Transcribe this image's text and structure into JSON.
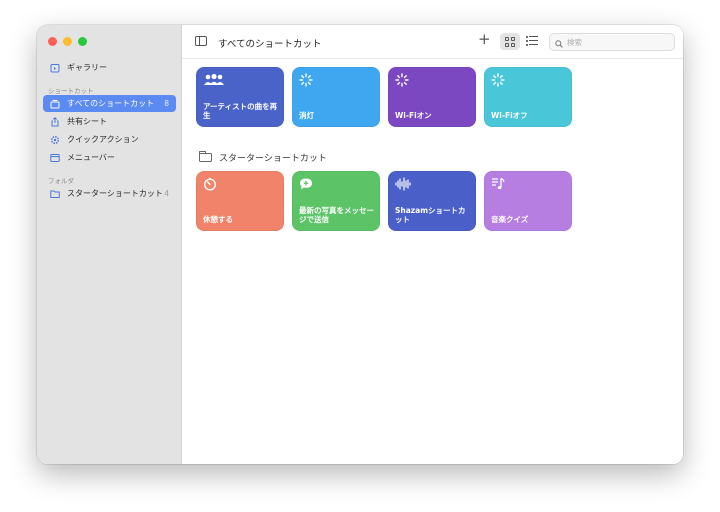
{
  "sidebar": {
    "top_items": [
      {
        "label": "ギャラリー",
        "icon": "gallery-icon"
      }
    ],
    "sections": [
      {
        "label": "ショートカット",
        "items": [
          {
            "label": "すべてのショートカット",
            "count": "8",
            "icon": "all-shortcuts-icon",
            "active": true
          },
          {
            "label": "共有シート",
            "count": "",
            "icon": "share-sheet-icon"
          },
          {
            "label": "クイックアクション",
            "count": "",
            "icon": "gear-icon"
          },
          {
            "label": "メニューバー",
            "count": "",
            "icon": "menubar-icon"
          }
        ]
      },
      {
        "label": "フォルダ",
        "items": [
          {
            "label": "スターターショートカット",
            "count": "4",
            "icon": "folder-icon"
          }
        ]
      }
    ]
  },
  "toolbar": {
    "title": "すべてのショートカット",
    "search_placeholder": "検索",
    "add_label": "+"
  },
  "main": {
    "tiles_row1": [
      {
        "label": "アーティストの曲を再生",
        "icon": "people-icon",
        "color": "#4a63c9"
      },
      {
        "label": "消灯",
        "icon": "sparkle-icon",
        "color": "#3ea7f0"
      },
      {
        "label": "Wi-Fiオン",
        "icon": "sparkle-icon",
        "color": "#7b48c2"
      },
      {
        "label": "Wi-Fiオフ",
        "icon": "sparkle-icon",
        "color": "#4ac6d9"
      }
    ],
    "folder": {
      "title": "スターターショートカット"
    },
    "tiles_row2": [
      {
        "label": "休憩する",
        "icon": "timer-icon",
        "color": "#f0836a"
      },
      {
        "label": "最新の写真をメッセージで送信",
        "icon": "message-icon",
        "color": "#5cc466"
      },
      {
        "label": "Shazamショートカット",
        "icon": "waveform-icon",
        "color": "#4a5fc7"
      },
      {
        "label": "音楽クイズ",
        "icon": "music-icon",
        "color": "#b57ee0"
      }
    ]
  }
}
